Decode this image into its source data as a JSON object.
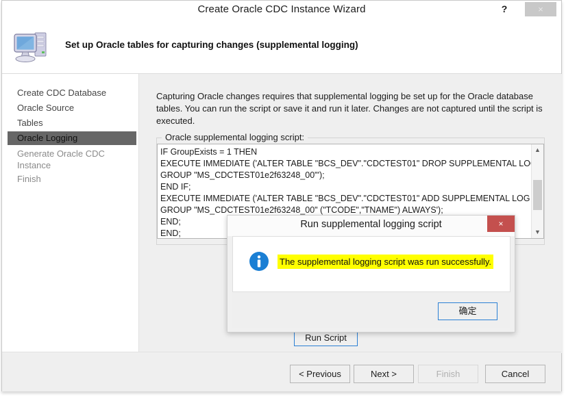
{
  "window": {
    "title": "Create Oracle CDC Instance Wizard",
    "help_icon": "?",
    "close_icon": "×"
  },
  "header": {
    "icon": "computer-icon",
    "title": "Set up Oracle tables for capturing changes (supplemental logging)"
  },
  "sidebar": {
    "items": [
      {
        "label": "Create CDC Database",
        "state": "done"
      },
      {
        "label": "Oracle Source",
        "state": "done"
      },
      {
        "label": "Tables",
        "state": "done"
      },
      {
        "label": "Oracle Logging",
        "state": "selected"
      },
      {
        "label": "Generate Oracle CDC Instance",
        "state": "upcoming"
      },
      {
        "label": "Finish",
        "state": "upcoming"
      }
    ]
  },
  "main": {
    "intro": "Capturing Oracle changes requires that supplemental logging be set up for the Oracle database tables. You can run the script or save it and run it later. Changes are not captured until the script is executed.",
    "group_label": "Oracle supplemental logging script:",
    "script": "IF GroupExists = 1 THEN\nEXECUTE IMMEDIATE ('ALTER TABLE \"BCS_DEV\".\"CDCTEST01\" DROP SUPPLEMENTAL LOG\nGROUP \"MS_CDCTEST01e2f63248_00\"');\nEND IF;\nEXECUTE IMMEDIATE ('ALTER TABLE \"BCS_DEV\".\"CDCTEST01\" ADD SUPPLEMENTAL LOG\nGROUP \"MS_CDCTEST01e2f63248_00\" (\"TCODE\",\"TNAME\") ALWAYS');\nEND;\nEND;\n/",
    "run_script_label": "Run Script",
    "save_script_label": "",
    "scrollbar": {
      "up_icon": "▲",
      "down_icon": "▼"
    }
  },
  "footer": {
    "previous_label": "< Previous",
    "next_label": "Next >",
    "finish_label": "Finish",
    "cancel_label": "Cancel"
  },
  "dialog": {
    "title": "Run supplemental logging script",
    "close_icon": "×",
    "info_icon": "info-icon",
    "message": "The supplemental logging script was run successfully.",
    "ok_label": "确定",
    "highlight_color": "#ffff00",
    "accent_color": "#2a7fd4",
    "close_color": "#c4504e"
  }
}
